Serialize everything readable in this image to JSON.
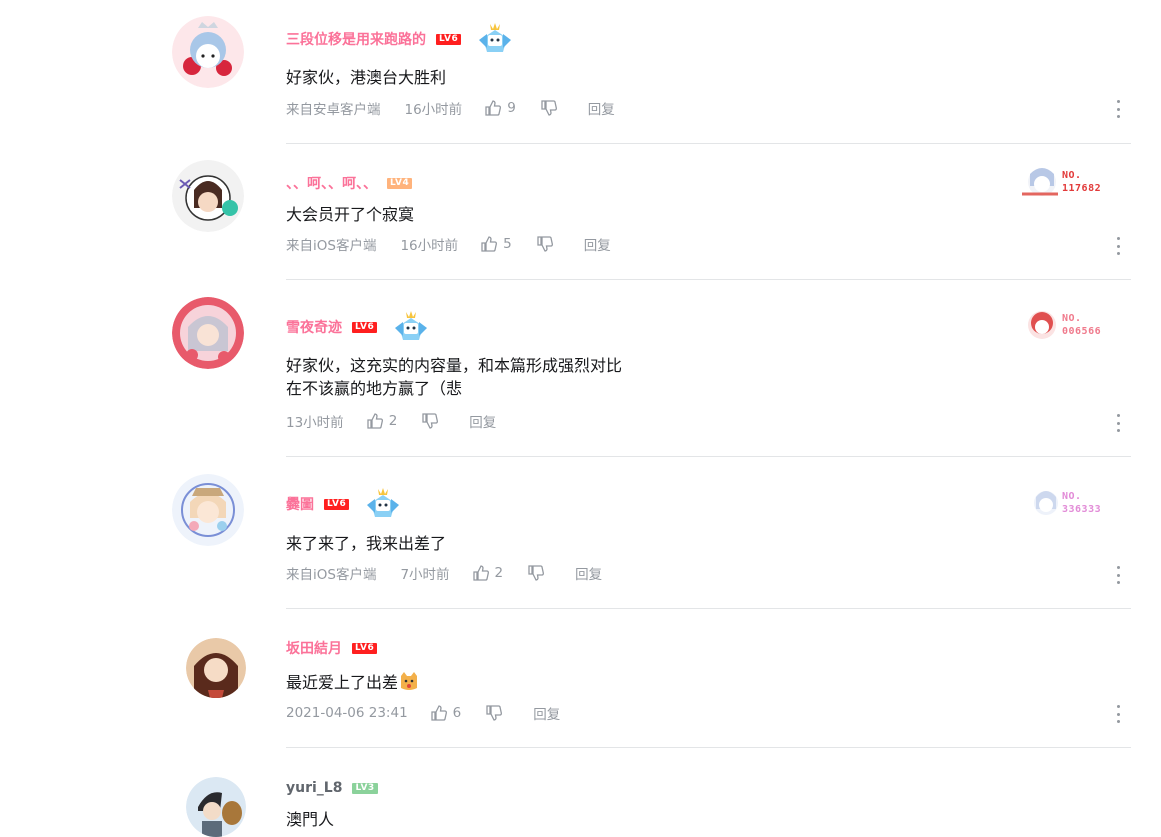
{
  "comments": [
    {
      "username": "三段位移是用来跑路的",
      "level": "LV6",
      "text": "好家伙，港澳台大胜利",
      "source": "来自安卓客户端",
      "time": "16小时前",
      "likes": "9",
      "reply": "回复"
    },
    {
      "username": "、、呵、、呵、、",
      "level": "LV4",
      "text": "大会员开了个寂寞",
      "source": "来自iOS客户端",
      "time": "16小时前",
      "likes": "5",
      "reply": "回复",
      "badge_label": "NO.",
      "badge_number": "117682"
    },
    {
      "username": "雪夜奇迹",
      "level": "LV6",
      "text": "好家伙，这充实的内容量，和本篇形成强烈对比\n在不该赢的地方赢了（悲",
      "time": "13小时前",
      "likes": "2",
      "reply": "回复",
      "badge_label": "NO.",
      "badge_number": "006566"
    },
    {
      "username": "爨圖",
      "level": "LV6",
      "text": "来了来了，我来出差了",
      "source": "来自iOS客户端",
      "time": "7小时前",
      "likes": "2",
      "reply": "回复",
      "badge_label": "NO.",
      "badge_number": "336333"
    },
    {
      "username": "坂田結月",
      "level": "LV6",
      "text": "最近爱上了出差",
      "time": "2021-04-06 23:41",
      "likes": "6",
      "reply": "回复"
    },
    {
      "username": "yuri_L8",
      "level": "LV3",
      "text": "澳門人"
    }
  ],
  "colors": {
    "vip_name": "#fb7299",
    "lv6": "#ff1f1f",
    "lv4": "#ffb37c",
    "lv3": "#8bd29b",
    "meta": "#9499a0",
    "divider": "#e3e5e7"
  },
  "icons": [
    "like-icon",
    "dislike-icon",
    "more-icon",
    "fan-medal-icon"
  ]
}
